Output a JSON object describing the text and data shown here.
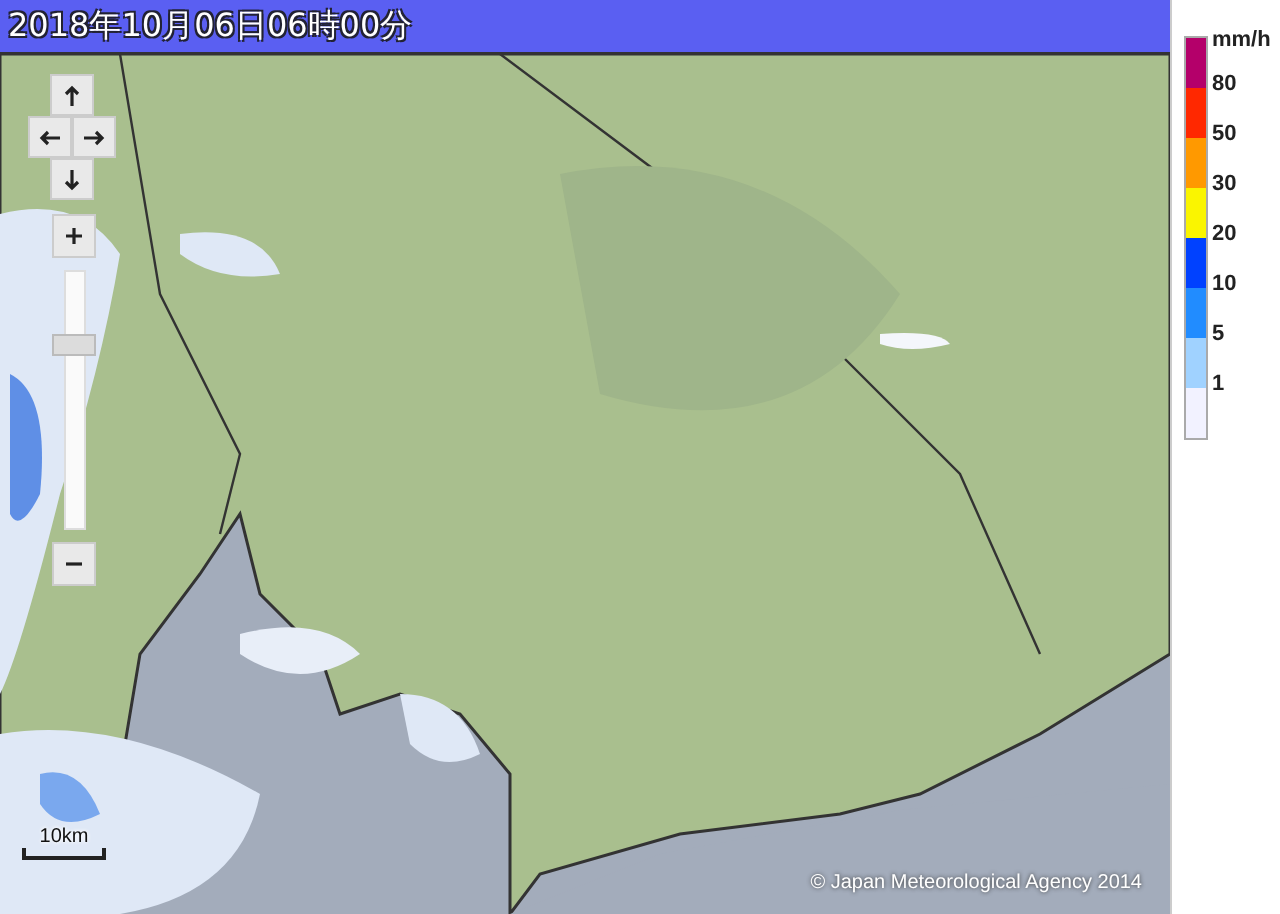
{
  "title": "2018年10月06日06時00分",
  "map": {
    "kind": "picture",
    "zoom": {
      "level": 0.72
    },
    "scale": "10km",
    "copyright": "© Japan Meteorological Agency 2014"
  },
  "legend": {
    "unit": "mm/h",
    "bands": [
      {
        "color": "#b4006a",
        "label": "80"
      },
      {
        "color": "#ff2800",
        "label": "50"
      },
      {
        "color": "#ff9900",
        "label": "30"
      },
      {
        "color": "#faf500",
        "label": "20"
      },
      {
        "color": "#0041ff",
        "label": "10"
      },
      {
        "color": "#218cff",
        "label": "5"
      },
      {
        "color": "#a0d2ff",
        "label": "1"
      },
      {
        "color": "#f2f2ff"
      }
    ]
  }
}
